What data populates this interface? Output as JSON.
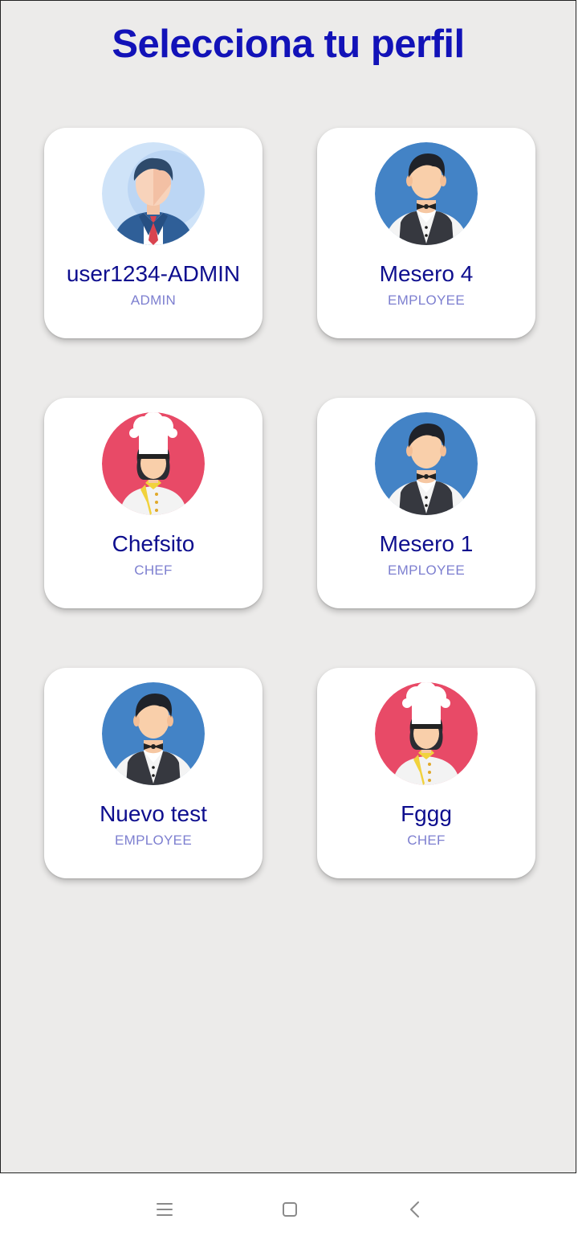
{
  "header": {
    "title": "Selecciona tu perfil"
  },
  "profiles": [
    {
      "name": "user1234-ADMIN",
      "role": "ADMIN",
      "avatar": "admin-avatar-icon"
    },
    {
      "name": "Mesero 4",
      "role": "EMPLOYEE",
      "avatar": "waiter-avatar-icon"
    },
    {
      "name": "Chefsito",
      "role": "CHEF",
      "avatar": "chef-avatar-icon"
    },
    {
      "name": "Mesero 1",
      "role": "EMPLOYEE",
      "avatar": "waiter-avatar-icon"
    },
    {
      "name": "Nuevo test",
      "role": "EMPLOYEE",
      "avatar": "waiter-avatar-icon"
    },
    {
      "name": "Fggg",
      "role": "CHEF",
      "avatar": "chef-avatar-icon"
    }
  ],
  "navbar": {
    "icons": [
      "menu-icon",
      "home-square-icon",
      "back-chevron-icon"
    ]
  },
  "colors": {
    "background": "#ecebea",
    "title": "#1212b8",
    "name": "#0e0e8e",
    "role": "#7d7fd0",
    "waiter_bg": "#4383c6",
    "chef_bg": "#e84a67",
    "admin_bg": "#cfe3f8"
  }
}
